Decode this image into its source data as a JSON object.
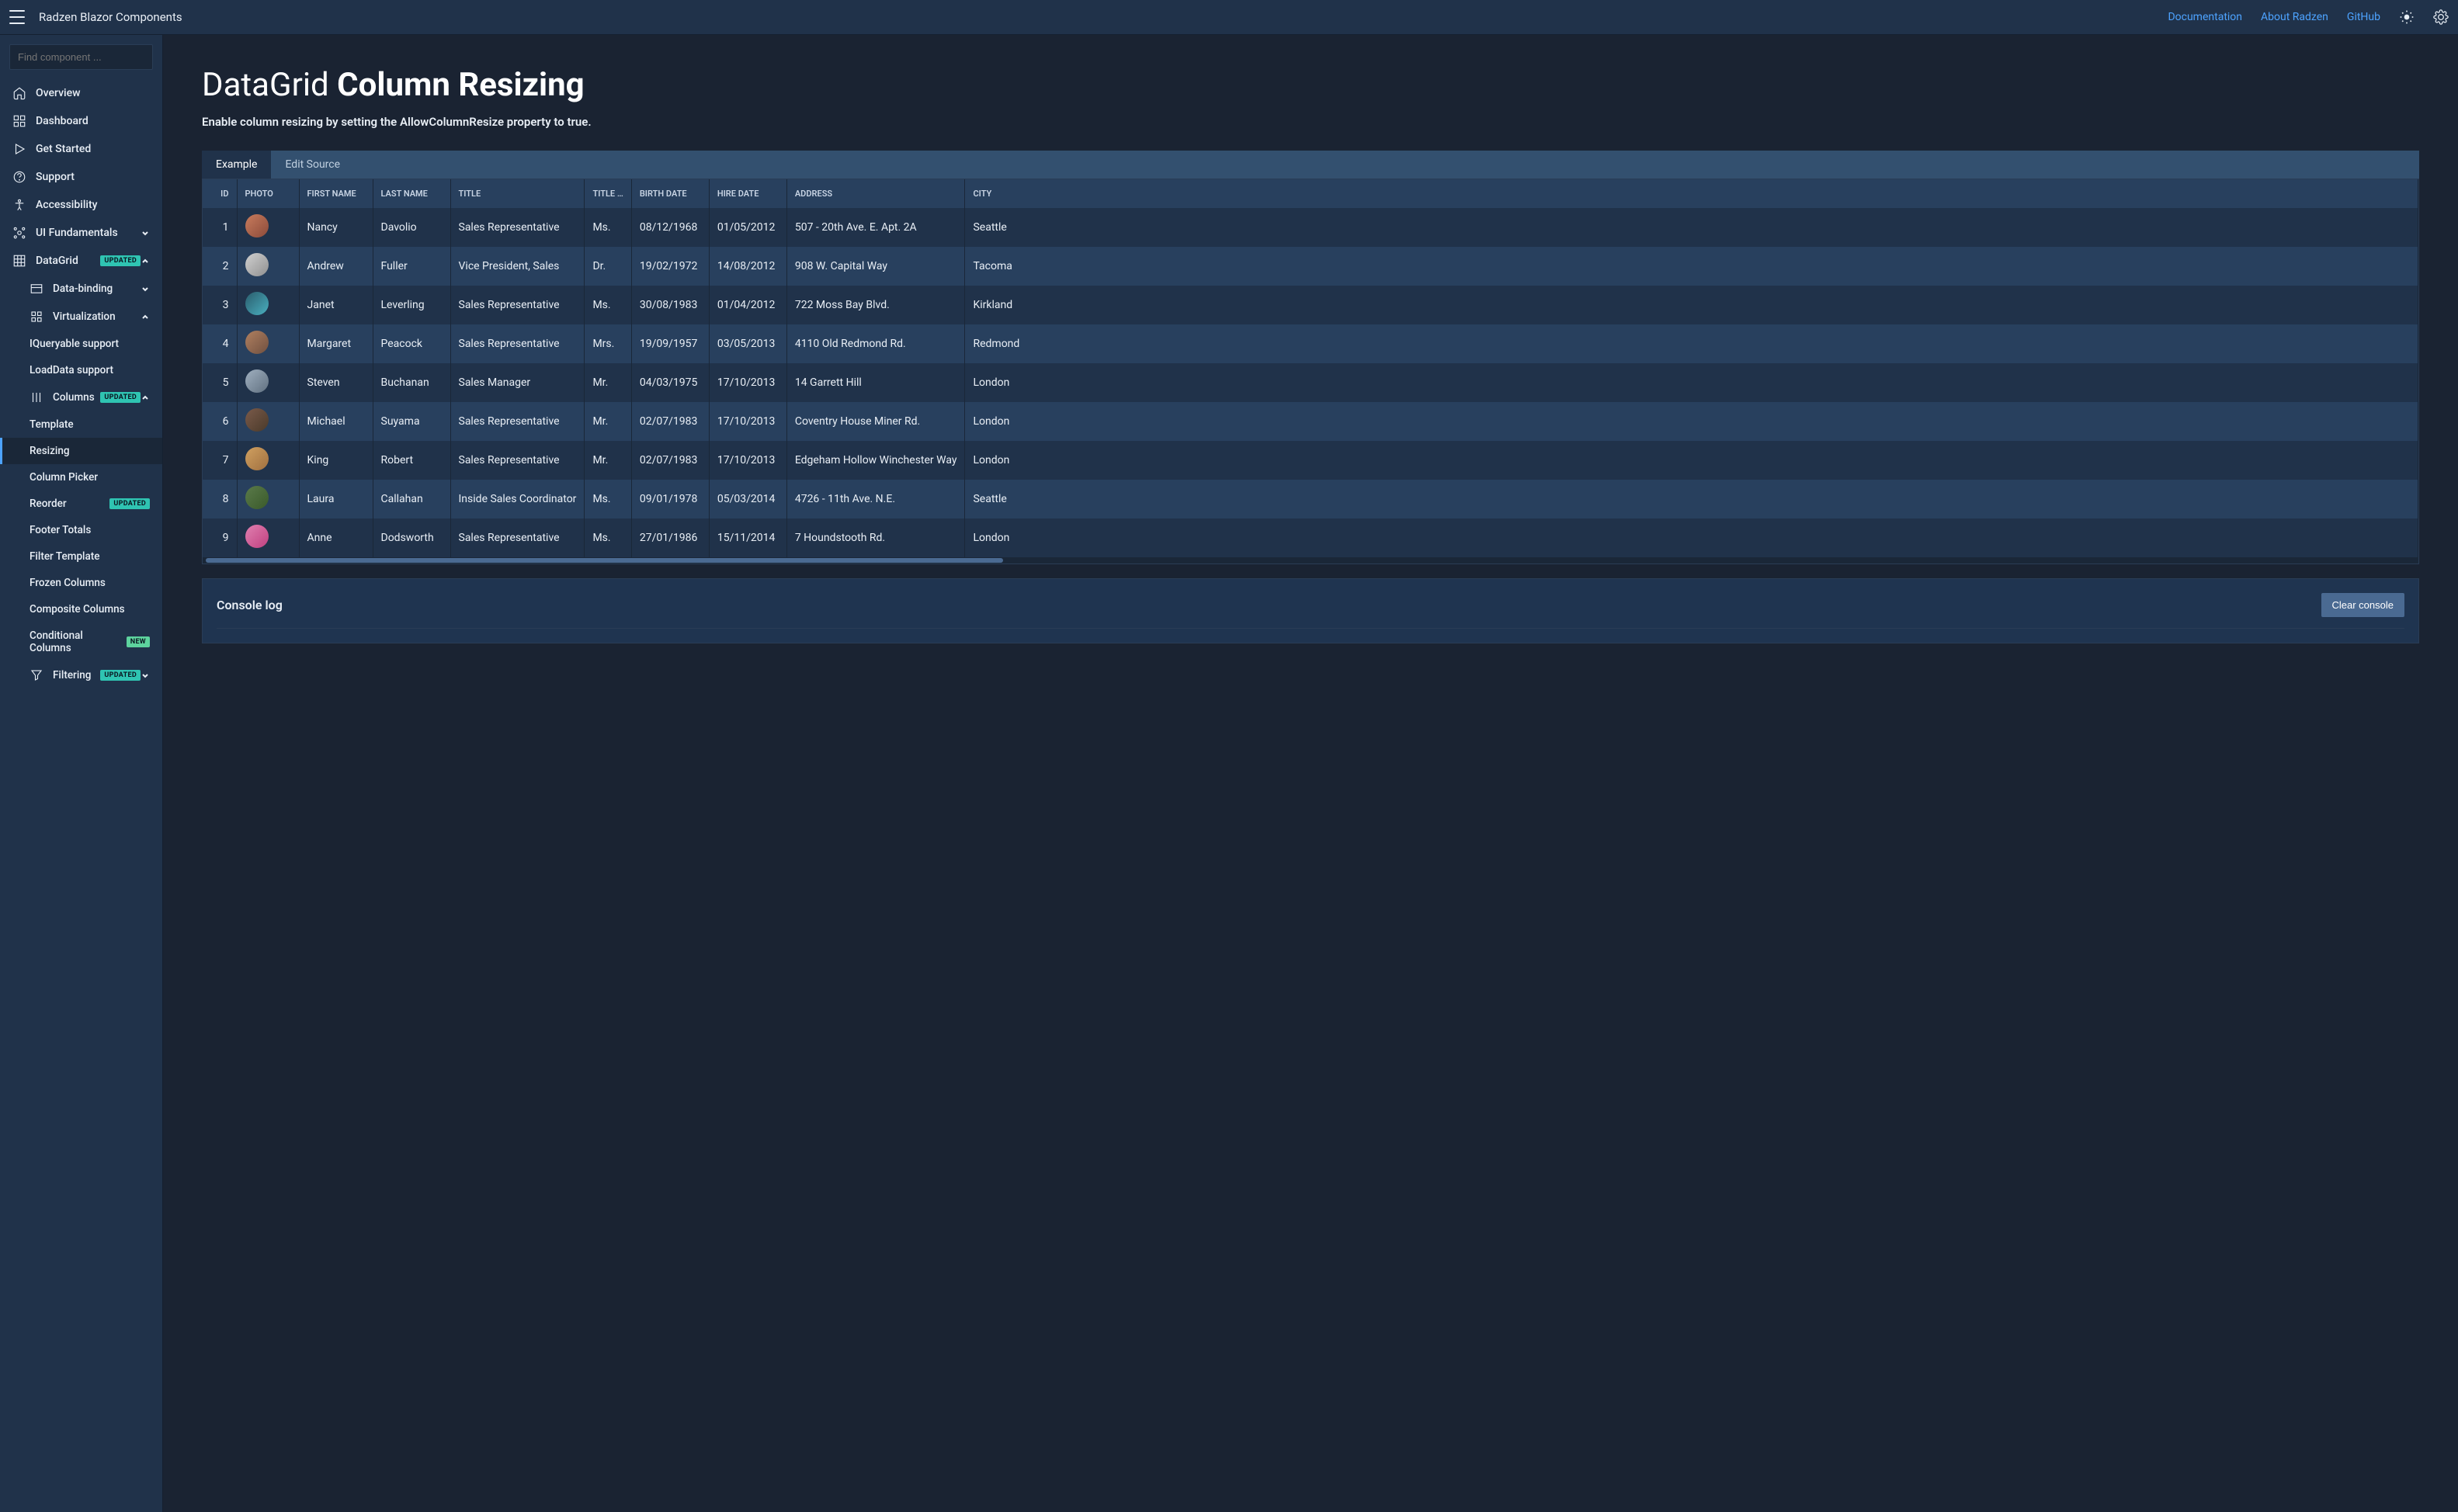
{
  "topbar": {
    "brand": "Radzen Blazor Components",
    "links": [
      "Documentation",
      "About Radzen",
      "GitHub"
    ]
  },
  "search": {
    "placeholder": "Find component ..."
  },
  "sidebar": {
    "items": [
      {
        "label": "Overview",
        "icon": "home"
      },
      {
        "label": "Dashboard",
        "icon": "dashboard"
      },
      {
        "label": "Get Started",
        "icon": "play"
      },
      {
        "label": "Support",
        "icon": "help"
      },
      {
        "label": "Accessibility",
        "icon": "accessibility"
      },
      {
        "label": "UI Fundamentals",
        "icon": "fundamentals",
        "chevron": "down"
      },
      {
        "label": "DataGrid",
        "icon": "grid",
        "badge": "UPDATED",
        "chevron": "up"
      },
      {
        "label": "Data-binding",
        "icon": "binding",
        "sub": true,
        "chevron": "down"
      },
      {
        "label": "Virtualization",
        "icon": "virtual",
        "sub": true,
        "chevron": "up"
      },
      {
        "label": "IQueryable support",
        "subsub": true
      },
      {
        "label": "LoadData support",
        "subsub": true
      },
      {
        "label": "Columns",
        "icon": "columns",
        "sub": true,
        "badge": "UPDATED",
        "chevron": "up"
      },
      {
        "label": "Template",
        "subsub": true
      },
      {
        "label": "Resizing",
        "subsub": true,
        "active": true
      },
      {
        "label": "Column Picker",
        "subsub": true
      },
      {
        "label": "Reorder",
        "subsub": true,
        "badge": "UPDATED"
      },
      {
        "label": "Footer Totals",
        "subsub": true
      },
      {
        "label": "Filter Template",
        "subsub": true
      },
      {
        "label": "Frozen Columns",
        "subsub": true
      },
      {
        "label": "Composite Columns",
        "subsub": true
      },
      {
        "label": "Conditional Columns",
        "subsub": true,
        "badge": "NEW"
      },
      {
        "label": "Filtering",
        "icon": "filter",
        "sub": true,
        "badge": "UPDATED",
        "chevron": "down"
      }
    ]
  },
  "page": {
    "title_thin": "DataGrid ",
    "title_bold": "Column Resizing",
    "description": "Enable column resizing by setting the AllowColumnResize property to true."
  },
  "tabs": [
    "Example",
    "Edit Source"
  ],
  "grid": {
    "headers": [
      "ID",
      "PHOTO",
      "FIRST NAME",
      "LAST NAME",
      "TITLE",
      "TITLE …",
      "BIRTH DATE",
      "HIRE DATE",
      "ADDRESS",
      "CITY"
    ],
    "rows": [
      {
        "id": "1",
        "first": "Nancy",
        "last": "Davolio",
        "title": "Sales Representative",
        "toc": "Ms.",
        "birth": "08/12/1968",
        "hire": "01/05/2012",
        "addr": "507 - 20th Ave. E. Apt. 2A",
        "city": "Seattle"
      },
      {
        "id": "2",
        "first": "Andrew",
        "last": "Fuller",
        "title": "Vice President, Sales",
        "toc": "Dr.",
        "birth": "19/02/1972",
        "hire": "14/08/2012",
        "addr": "908 W. Capital Way",
        "city": "Tacoma"
      },
      {
        "id": "3",
        "first": "Janet",
        "last": "Leverling",
        "title": "Sales Representative",
        "toc": "Ms.",
        "birth": "30/08/1983",
        "hire": "01/04/2012",
        "addr": "722 Moss Bay Blvd.",
        "city": "Kirkland"
      },
      {
        "id": "4",
        "first": "Margaret",
        "last": "Peacock",
        "title": "Sales Representative",
        "toc": "Mrs.",
        "birth": "19/09/1957",
        "hire": "03/05/2013",
        "addr": "4110 Old Redmond Rd.",
        "city": "Redmond"
      },
      {
        "id": "5",
        "first": "Steven",
        "last": "Buchanan",
        "title": "Sales Manager",
        "toc": "Mr.",
        "birth": "04/03/1975",
        "hire": "17/10/2013",
        "addr": "14 Garrett Hill",
        "city": "London"
      },
      {
        "id": "6",
        "first": "Michael",
        "last": "Suyama",
        "title": "Sales Representative",
        "toc": "Mr.",
        "birth": "02/07/1983",
        "hire": "17/10/2013",
        "addr": "Coventry House Miner Rd.",
        "city": "London"
      },
      {
        "id": "7",
        "first": "King",
        "last": "Robert",
        "title": "Sales Representative",
        "toc": "Mr.",
        "birth": "02/07/1983",
        "hire": "17/10/2013",
        "addr": "Edgeham Hollow Winchester Way",
        "city": "London"
      },
      {
        "id": "8",
        "first": "Laura",
        "last": "Callahan",
        "title": "Inside Sales Coordinator",
        "toc": "Ms.",
        "birth": "09/01/1978",
        "hire": "05/03/2014",
        "addr": "4726 - 11th Ave. N.E.",
        "city": "Seattle"
      },
      {
        "id": "9",
        "first": "Anne",
        "last": "Dodsworth",
        "title": "Sales Representative",
        "toc": "Ms.",
        "birth": "27/01/1986",
        "hire": "15/11/2014",
        "addr": "7 Houndstooth Rd.",
        "city": "London"
      }
    ]
  },
  "console": {
    "title": "Console log",
    "clear": "Clear console"
  }
}
